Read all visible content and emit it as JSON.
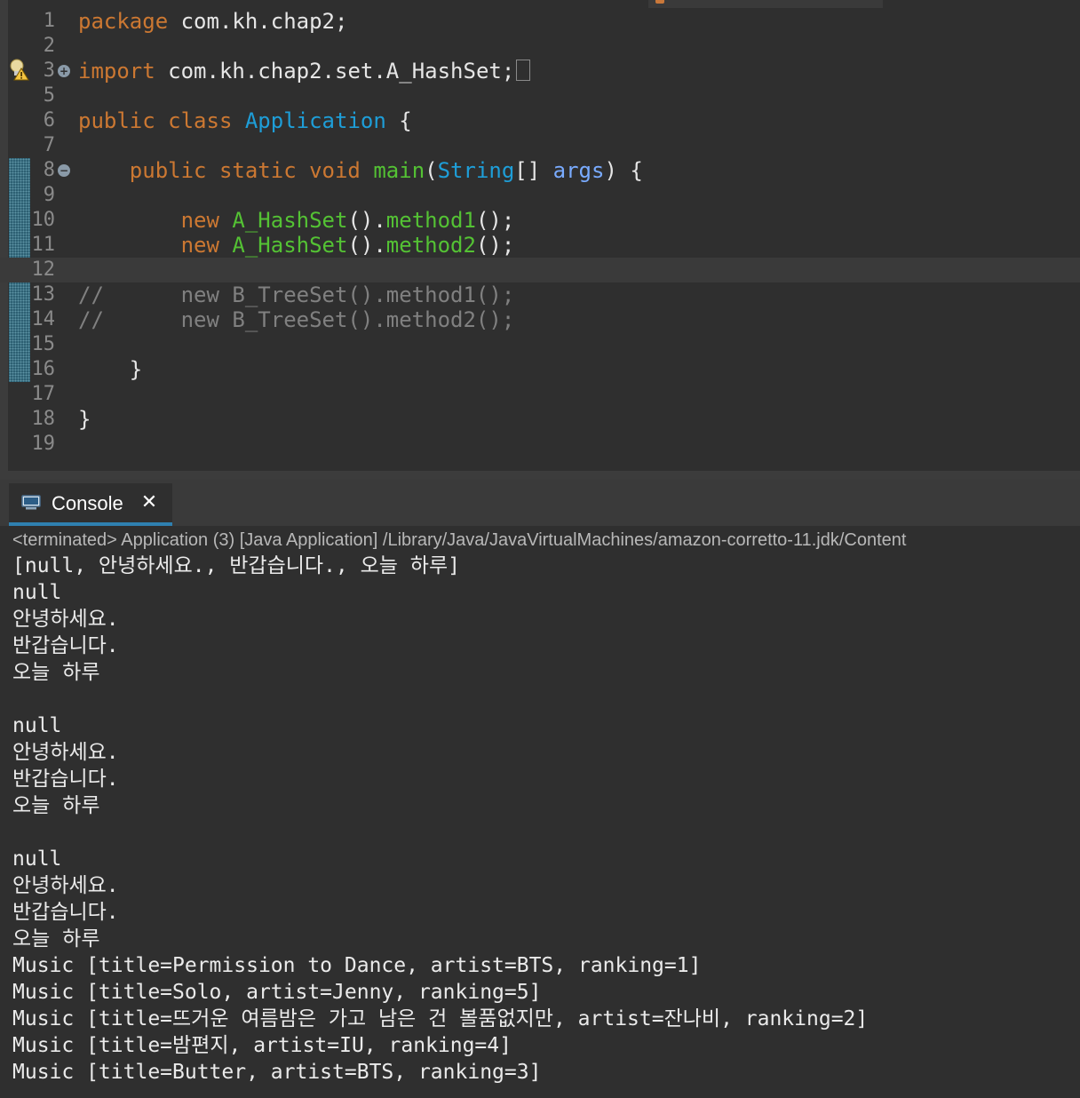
{
  "editor": {
    "lines": [
      {
        "num": "1",
        "tokens": [
          {
            "t": "package ",
            "c": "kw"
          },
          {
            "t": "com.kh.chap2;",
            "c": "txt"
          }
        ]
      },
      {
        "num": "2",
        "tokens": []
      },
      {
        "num": "3",
        "tokens": [
          {
            "t": "import ",
            "c": "kw"
          },
          {
            "t": "com.kh.chap2.set.A_HashSet;",
            "c": "txt"
          }
        ],
        "fold": "+",
        "collapsed": true,
        "warning": true
      },
      {
        "num": "5",
        "tokens": []
      },
      {
        "num": "6",
        "tokens": [
          {
            "t": "public class ",
            "c": "kw"
          },
          {
            "t": "Application",
            "c": "type"
          },
          {
            "t": " {",
            "c": "txt"
          }
        ]
      },
      {
        "num": "7",
        "tokens": []
      },
      {
        "num": "8",
        "tokens": [
          {
            "t": "    public static void ",
            "c": "kw"
          },
          {
            "t": "main",
            "c": "method"
          },
          {
            "t": "(",
            "c": "txt"
          },
          {
            "t": "String",
            "c": "type"
          },
          {
            "t": "[] ",
            "c": "txt"
          },
          {
            "t": "args",
            "c": "param"
          },
          {
            "t": ") {",
            "c": "txt"
          }
        ],
        "fold": "−"
      },
      {
        "num": "9",
        "tokens": []
      },
      {
        "num": "10",
        "tokens": [
          {
            "t": "        new ",
            "c": "kw"
          },
          {
            "t": "A_HashSet",
            "c": "method"
          },
          {
            "t": "().",
            "c": "txt"
          },
          {
            "t": "method1",
            "c": "method"
          },
          {
            "t": "();",
            "c": "txt"
          }
        ]
      },
      {
        "num": "11",
        "tokens": [
          {
            "t": "        new ",
            "c": "kw"
          },
          {
            "t": "A_HashSet",
            "c": "method"
          },
          {
            "t": "().",
            "c": "txt"
          },
          {
            "t": "method2",
            "c": "method"
          },
          {
            "t": "();",
            "c": "txt"
          }
        ]
      },
      {
        "num": "12",
        "tokens": [],
        "current": true
      },
      {
        "num": "13",
        "tokens": [
          {
            "t": "//      new B_TreeSet().method1();",
            "c": "cmt"
          }
        ]
      },
      {
        "num": "14",
        "tokens": [
          {
            "t": "//      new B_TreeSet().method2();",
            "c": "cmt"
          }
        ]
      },
      {
        "num": "15",
        "tokens": []
      },
      {
        "num": "16",
        "tokens": [
          {
            "t": "    }",
            "c": "txt"
          }
        ]
      },
      {
        "num": "17",
        "tokens": []
      },
      {
        "num": "18",
        "tokens": [
          {
            "t": "}",
            "c": "txt"
          }
        ]
      },
      {
        "num": "19",
        "tokens": []
      }
    ]
  },
  "console": {
    "tab_label": "Console",
    "tab_icon": "console-monitor-icon",
    "close_icon": "close-x-icon",
    "status": "<terminated> Application (3) [Java Application] /Library/Java/JavaVirtualMachines/amazon-corretto-11.jdk/Content",
    "output": [
      "[null, 안녕하세요., 반갑습니다., 오늘 하루]",
      "null",
      "안녕하세요.",
      "반갑습니다.",
      "오늘 하루",
      "",
      "null",
      "안녕하세요.",
      "반갑습니다.",
      "오늘 하루",
      "",
      "null",
      "안녕하세요.",
      "반갑습니다.",
      "오늘 하루",
      "Music [title=Permission to Dance, artist=BTS, ranking=1]",
      "Music [title=Solo, artist=Jenny, ranking=5]",
      "Music [title=뜨거운 여름밤은 가고 남은 건 볼품없지만, artist=잔나비, ranking=2]",
      "Music [title=밤편지, artist=IU, ranking=4]",
      "Music [title=Butter, artist=BTS, ranking=3]"
    ]
  },
  "colors": {
    "background": "#2f2f2f",
    "keyword": "#cc7832",
    "type": "#1e9ed8",
    "method": "#54c234",
    "param": "#79abff",
    "comment": "#808080",
    "tab_underline": "#2f80b0"
  }
}
